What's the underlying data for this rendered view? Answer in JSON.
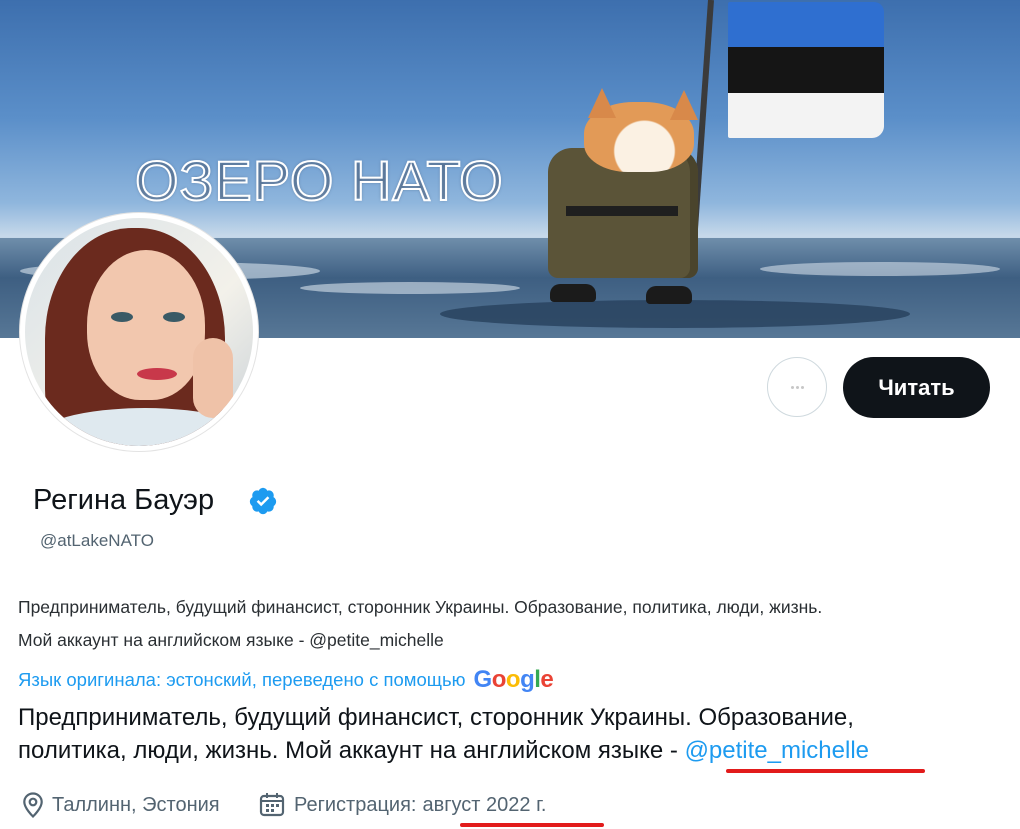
{
  "banner": {
    "title": "ОЗЕРО НАТО"
  },
  "profile": {
    "name": "Регина Бауэр",
    "handle": "@atLakeNATO",
    "verified_color": "#1d9bf0"
  },
  "actions": {
    "follow_label": "Читать"
  },
  "bio": {
    "line1": "Предприниматель, будущий финансист, сторонник Украины. Образование, политика, люди, жизнь.",
    "line2": "Мой аккаунт на английском языке - @petite_michelle"
  },
  "translation": {
    "notice": "Язык оригинала: эстонский, переведено с помощью",
    "google_letters": [
      "G",
      "o",
      "o",
      "g",
      "l",
      "e"
    ],
    "line1": "Предприниматель, будущий финансист, сторонник Украины. Образование,",
    "line2_text": "политика, люди, жизнь. Мой аккаунт на английском языке - ",
    "line2_mention": "@petite_michelle"
  },
  "meta": {
    "location": "Таллинн, Эстония",
    "registration_label": "Регистрация: ",
    "registration_date": "август 2022 г."
  },
  "colors": {
    "accent": "#1d9bf0",
    "highlight": "#e21b1b",
    "button": "#0f1419"
  }
}
